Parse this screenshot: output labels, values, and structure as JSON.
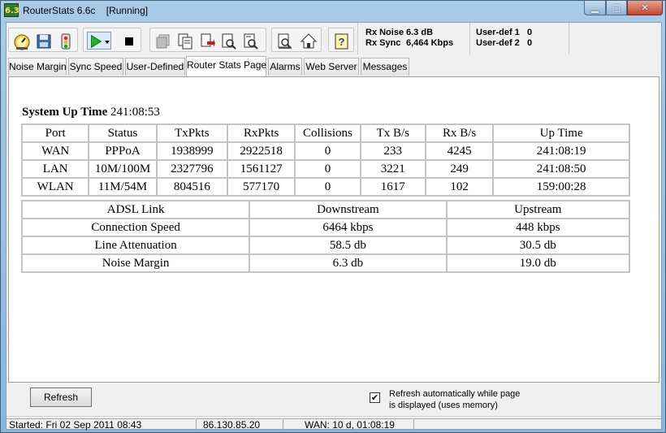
{
  "window": {
    "icon_text": "6.3",
    "title": "RouterStats 6.6c",
    "state": "[Running]",
    "buttons": {
      "minimize": "▁",
      "maximize": "□",
      "close": "✕"
    }
  },
  "toolbar": {
    "icons": [
      "speedometer-icon",
      "save-icon",
      "signal-icon",
      "play-icon",
      "dropdown-icon",
      "stop-icon",
      "stack-icon",
      "copy-icon",
      "paste-icon",
      "find-icon",
      "find-next-icon",
      "report-icon",
      "home-icon",
      "help-icon"
    ]
  },
  "stats": {
    "rx_noise_label": "Rx Noise",
    "rx_noise_value": "6.3 dB",
    "rx_sync_label": "Rx Sync",
    "rx_sync_value": "6,464 Kbps",
    "user_def1_label": "User-def 1",
    "user_def1_value": "0",
    "user_def2_label": "User-def 2",
    "user_def2_value": "0"
  },
  "tabs": [
    "Noise Margin",
    "Sync Speed",
    "User-Defined",
    "Router Stats Page",
    "Alarms",
    "Web Server",
    "Messages"
  ],
  "active_tab": "Router Stats Page",
  "page": {
    "uptime_label": "System Up Time",
    "uptime_value": "241:08:53",
    "ports_table": {
      "headers": [
        "Port",
        "Status",
        "TxPkts",
        "RxPkts",
        "Collisions",
        "Tx B/s",
        "Rx B/s",
        "Up Time"
      ],
      "rows": [
        [
          "WAN",
          "PPPoA",
          "1938999",
          "2922518",
          "0",
          "233",
          "4245",
          "241:08:19"
        ],
        [
          "LAN",
          "10M/100M",
          "2327796",
          "1561127",
          "0",
          "3221",
          "249",
          "241:08:50"
        ],
        [
          "WLAN",
          "11M/54M",
          "804516",
          "577170",
          "0",
          "1617",
          "102",
          "159:00:28"
        ]
      ]
    },
    "adsl_table": {
      "headers": [
        "ADSL Link",
        "Downstream",
        "Upstream"
      ],
      "rows": [
        [
          "Connection Speed",
          "6464 kbps",
          "448 kbps"
        ],
        [
          "Line Attenuation",
          "58.5 db",
          "30.5 db"
        ],
        [
          "Noise Margin",
          "6.3 db",
          "19.0 db"
        ]
      ]
    }
  },
  "bottom": {
    "refresh_label": "Refresh",
    "auto_refresh_checked": "✔",
    "auto_refresh_line1": "Refresh automatically while page",
    "auto_refresh_line2": "is displayed (uses memory)"
  },
  "statusbar": {
    "started": "Started: Fri 02 Sep 2011   08:43",
    "ip": "86.130.85.20",
    "wan": "WAN: 10 d, 01:08:19"
  },
  "colors": {
    "play_green": "#1fb31f",
    "title_blue": "#a9cbe6",
    "close_red": "#c4452b"
  }
}
